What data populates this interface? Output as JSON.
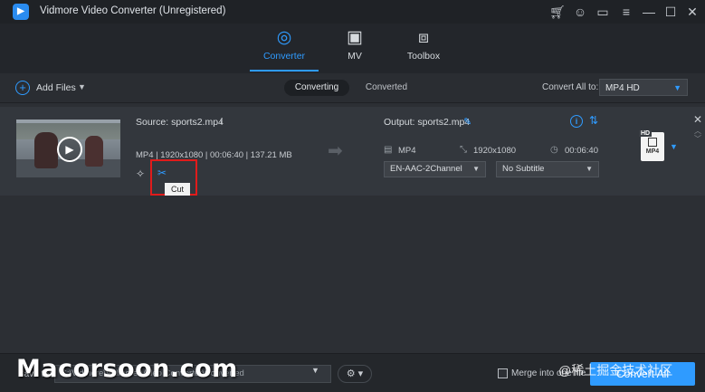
{
  "window": {
    "title": "Vidmore Video Converter (Unregistered)",
    "logo_icon": "vidmore-logo-icon",
    "controls": [
      "cart-icon",
      "user-icon",
      "chat-icon",
      "menu-icon",
      "minimize-icon",
      "maximize-icon",
      "close-icon"
    ]
  },
  "nav": {
    "tabs": [
      {
        "label": "Converter",
        "icon": "converter-icon",
        "active": true
      },
      {
        "label": "MV",
        "icon": "mv-icon",
        "active": false
      },
      {
        "label": "Toolbox",
        "icon": "toolbox-icon",
        "active": false
      }
    ],
    "accent": "#2f9bff"
  },
  "toolbar": {
    "add_files": "Add Files",
    "seg_converting": "Converting",
    "seg_converted": "Converted",
    "convert_all_to_label": "Convert All to:",
    "convert_all_to_value": "MP4 HD"
  },
  "file": {
    "source": "Source: sports2.mp4",
    "meta": "MP4 | 1920x1080 | 00:06:40 | 137.21 MB",
    "output": "Output: sports2.mp4",
    "out_format": "MP4",
    "out_resolution": "1920x1080",
    "out_duration": "00:06:40",
    "audio_track": "EN-AAC-2Channel",
    "subtitle": "No Subtitle",
    "tooltip": "Cut",
    "format_badge": "HD",
    "format_name": "MP4",
    "highlight_color": "#e01b1b"
  },
  "bottom": {
    "save_to": "Save to:",
    "save_path": "C:\\Vidmore\\Vidmore Video Converter\\Converted",
    "merge_label": "Merge into one file",
    "convert_all": "Convert All"
  },
  "watermarks": {
    "left": "Macorsoon.com",
    "right": "@稀土掘金技术社区"
  }
}
